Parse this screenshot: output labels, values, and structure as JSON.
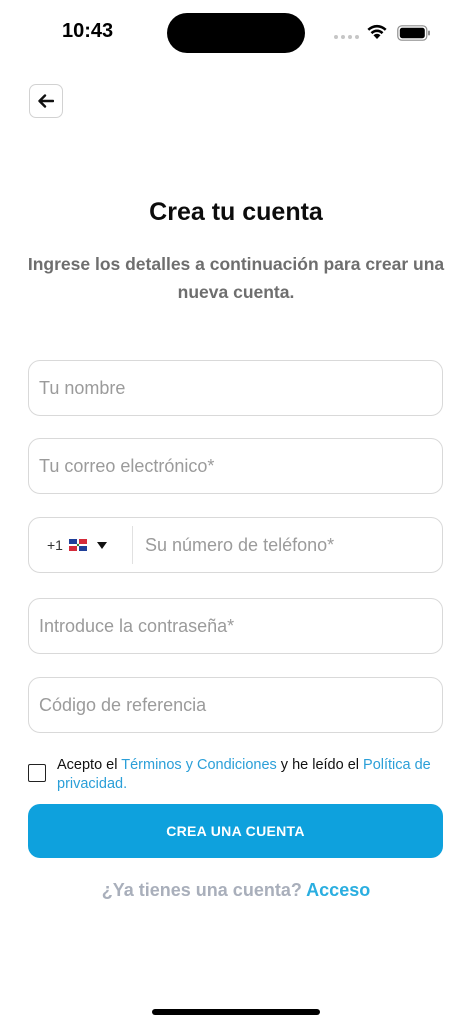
{
  "status_bar": {
    "time": "10:43",
    "icons": [
      "signal-dots-icon",
      "wifi-icon",
      "battery-icon"
    ]
  },
  "header": {
    "back_icon": "arrow-left-icon"
  },
  "main": {
    "title": "Crea tu cuenta",
    "subtitle": "Ingrese los detalles a continuación para crear una nueva cuenta."
  },
  "form": {
    "name": {
      "placeholder": "Tu nombre",
      "value": ""
    },
    "email": {
      "placeholder": "Tu correo electrónico*",
      "value": ""
    },
    "phone": {
      "country_code": "+1",
      "flag": "dominican-republic-flag-icon",
      "placeholder": "Su número de teléfono*",
      "value": ""
    },
    "password": {
      "placeholder": "Introduce la contraseña*",
      "value": ""
    },
    "referral": {
      "placeholder": "Código de referencia",
      "value": ""
    },
    "terms": {
      "checked": false,
      "text_1": "Acepto el ",
      "terms_link": "Términos y Condiciones",
      "text_2": " y he leído el ",
      "privacy_link": "Política de privacidad."
    },
    "submit_label": "CREA UNA CUENTA"
  },
  "footer": {
    "question": "¿Ya tienes una cuenta?",
    "login_link": "Acceso"
  },
  "colors": {
    "accent": "#0ea1dd",
    "link": "#2b9fd8",
    "muted": "#9b9b9b"
  }
}
